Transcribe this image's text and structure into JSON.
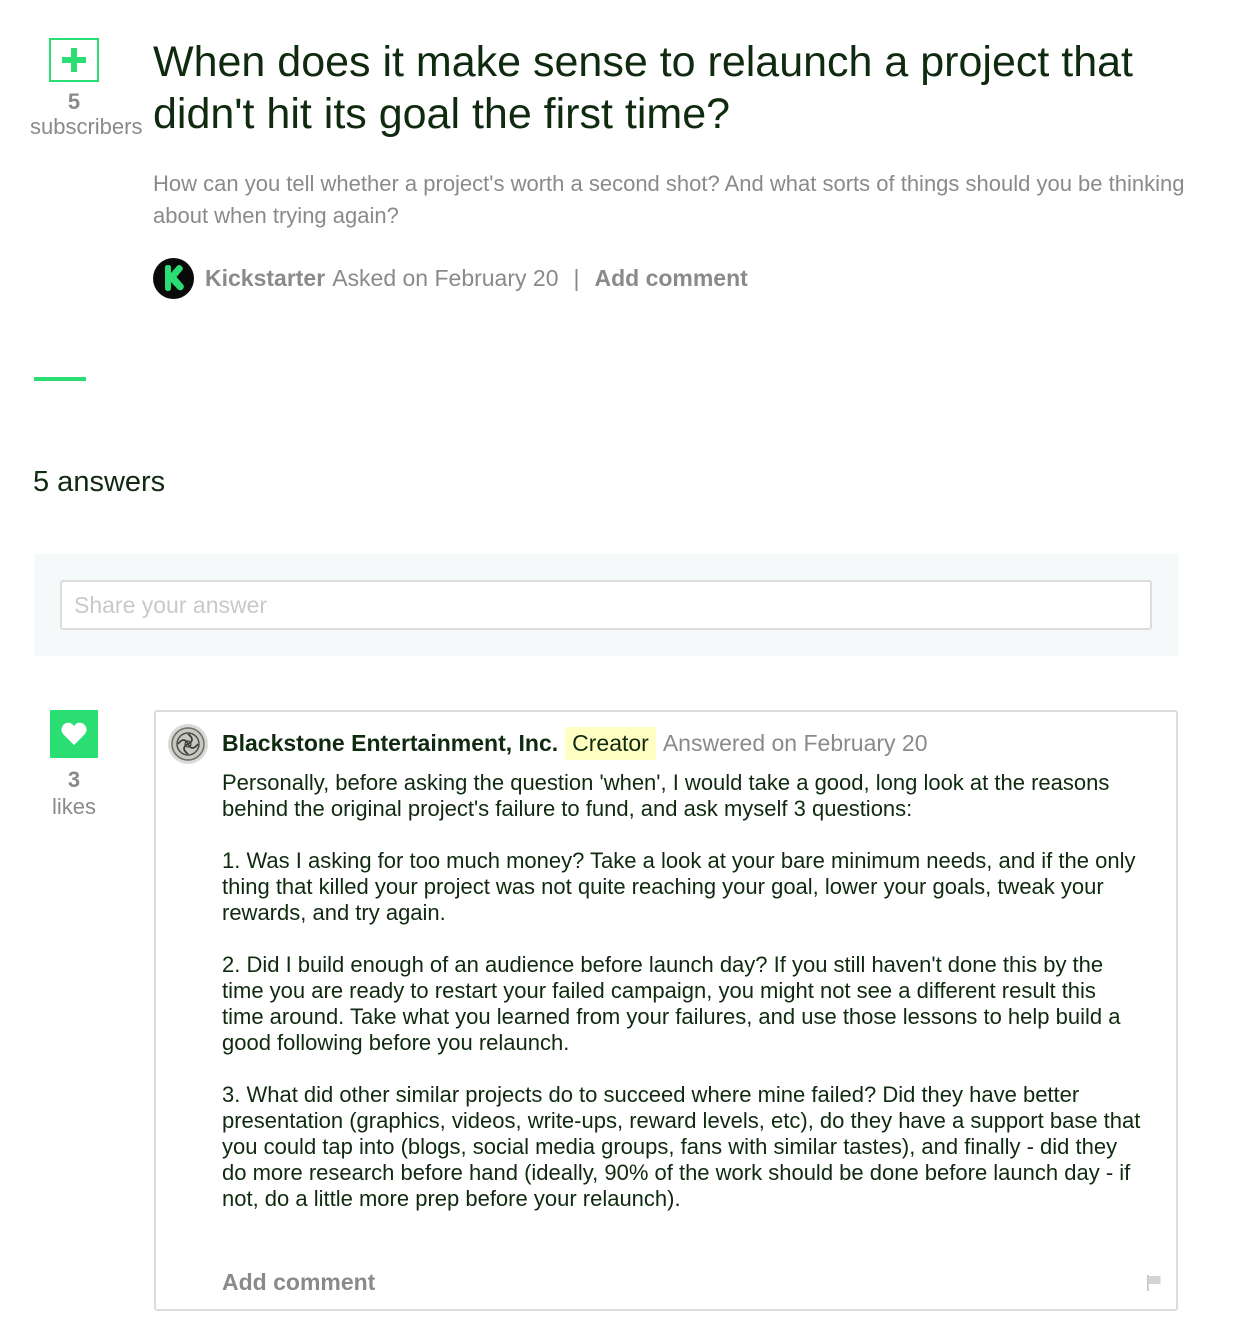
{
  "question": {
    "title": "When does it make sense to relaunch a project that didn't hit its goal the first time?",
    "description": "How can you tell whether a project's worth a second shot? And what sorts of things should you be thinking about when trying again?",
    "subscriber_count": "5",
    "subscriber_label": "subscribers",
    "asker_avatar_letter": "K",
    "asker_name": "Kickstarter",
    "asked_text": "Asked on February 20",
    "separator": "|",
    "add_comment_label": "Add comment"
  },
  "answers_heading": "5 answers",
  "share": {
    "placeholder": "Share your answer"
  },
  "answer": {
    "like_count": "3",
    "like_label": "likes",
    "author": "Blackstone Entertainment, Inc.",
    "badge": "Creator",
    "answered_text": "Answered on February 20",
    "paragraphs": [
      "Personally, before asking the question 'when', I would take a good, long look at the reasons behind the original project's failure to fund, and ask myself 3 questions:",
      "1. Was I asking for too much money? Take a look at your bare minimum needs, and if the only thing that killed your project was not quite reaching your goal, lower your goals, tweak your rewards, and try again.",
      "2. Did I build enough of an audience before launch day? If you still haven't done this by the time you are ready to restart your failed campaign, you might not see a different result this time around. Take what you learned from your failures, and use those lessons to help build a good following before you relaunch.",
      "3. What did other similar projects do to succeed where mine failed? Did they have better presentation (graphics, videos, write-ups, reward levels, etc), do they have a support base that you could tap into (blogs, social media groups, fans with similar tastes), and finally - did they do more research before hand (ideally, 90% of the work should be done before launch day - if not, do a little more prep before your relaunch)."
    ],
    "add_comment_label": "Add comment"
  },
  "colors": {
    "accent_green": "#2bde73",
    "text_dark": "#0f2a0f",
    "text_muted": "#8a8a8a",
    "badge_bg": "#ffffc4",
    "share_bg": "#f6f9f9"
  },
  "icons": {
    "subscribe": "plus-icon",
    "like": "heart-icon",
    "flag": "flag-icon"
  }
}
